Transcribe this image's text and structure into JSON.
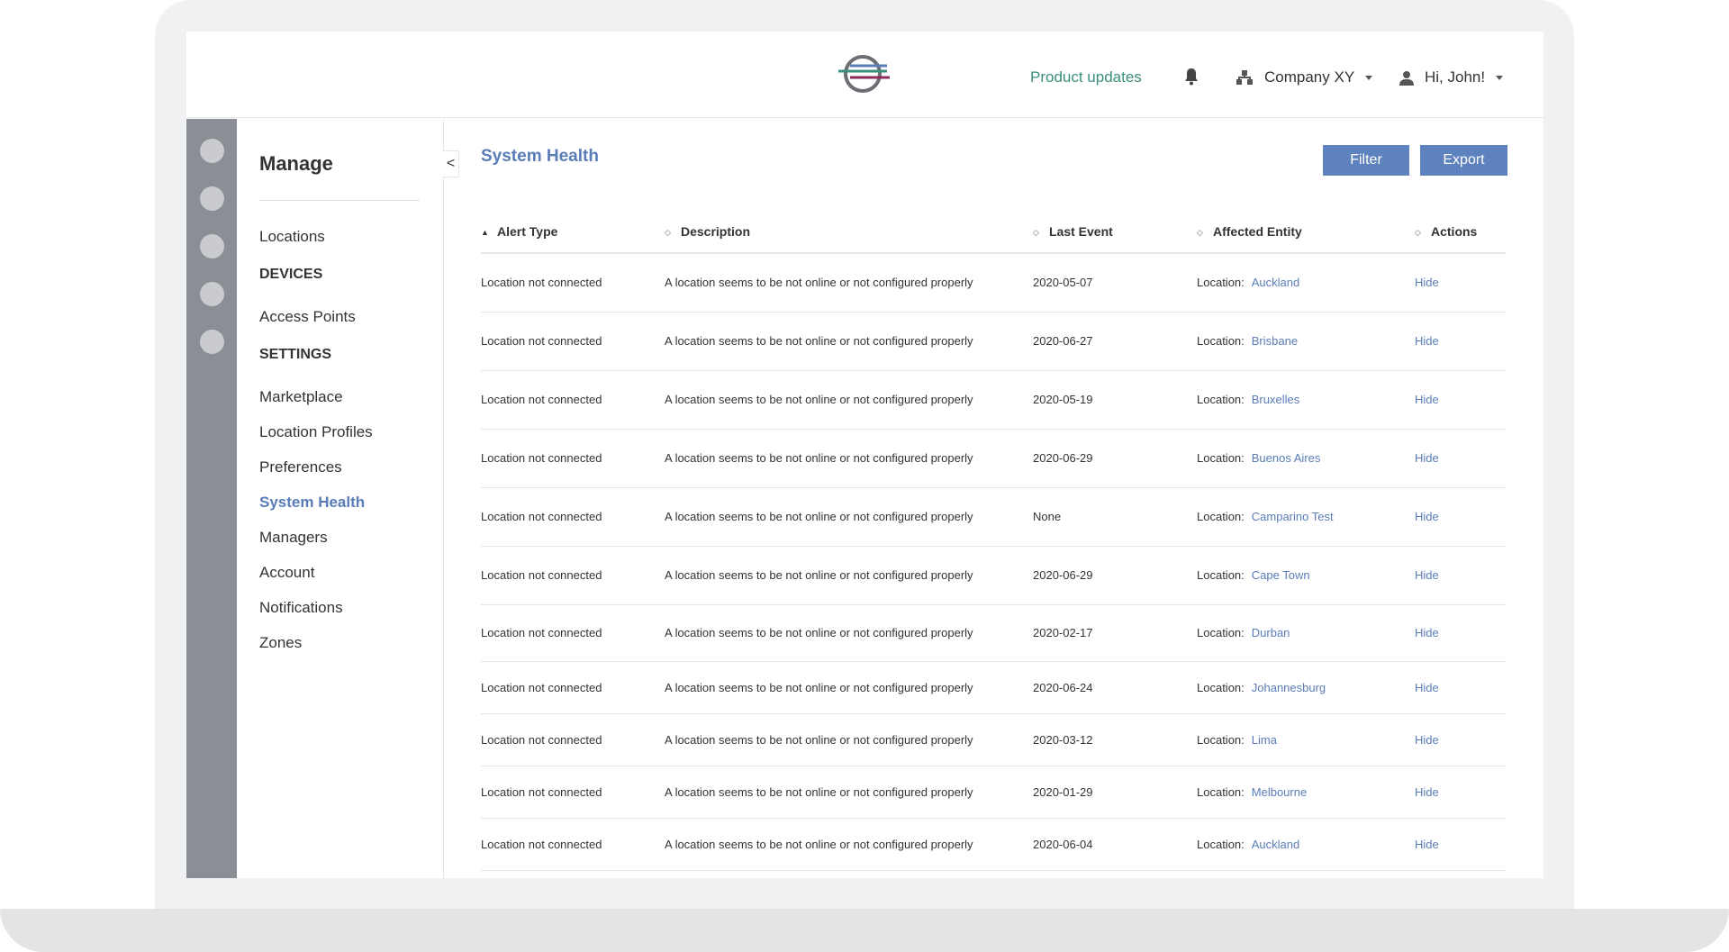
{
  "header": {
    "product_updates": "Product updates",
    "company": "Company XY",
    "greeting": "Hi, John!"
  },
  "rail": {
    "items": [
      "nav-dot",
      "nav-dot",
      "nav-dot",
      "nav-dot",
      "nav-dot"
    ]
  },
  "sidenav": {
    "title": "Manage",
    "locations": "Locations",
    "devices_heading": "DEVICES",
    "access_points": "Access Points",
    "settings_heading": "SETTINGS",
    "marketplace": "Marketplace",
    "location_profiles": "Location Profiles",
    "preferences": "Preferences",
    "system_health": "System Health",
    "managers": "Managers",
    "account": "Account",
    "notifications": "Notifications",
    "zones": "Zones",
    "collapse_glyph": "<"
  },
  "main": {
    "title": "System Health",
    "filter_label": "Filter",
    "export_label": "Export",
    "columns": [
      "Alert Type",
      "Description",
      "Last Event",
      "Affected Entity",
      "Actions"
    ],
    "location_prefix": "Location:",
    "rows": [
      {
        "alert": "Location not connected",
        "desc": "A location seems to be not online or not configured properly",
        "last": "2020-05-07",
        "entity": "Auckland",
        "action": "Hide"
      },
      {
        "alert": "Location not connected",
        "desc": "A location seems to be not online or not configured properly",
        "last": "2020-06-27",
        "entity": "Brisbane",
        "action": "Hide"
      },
      {
        "alert": "Location not connected",
        "desc": "A location seems to be not online or not configured properly",
        "last": "2020-05-19",
        "entity": "Bruxelles",
        "action": "Hide"
      },
      {
        "alert": "Location not connected",
        "desc": "A location seems to be not online or not configured properly",
        "last": "2020-06-29",
        "entity": "Buenos Aires",
        "action": "Hide"
      },
      {
        "alert": "Location not connected",
        "desc": "A location seems to be not online or not configured properly",
        "last": "None",
        "entity": "Camparino Test",
        "action": "Hide"
      },
      {
        "alert": "Location not connected",
        "desc": "A location seems to be not online or not configured properly",
        "last": "2020-06-29",
        "entity": "Cape Town",
        "action": "Hide"
      },
      {
        "alert": "Location not connected",
        "desc": "A location seems to be not online or not configured properly",
        "last": "2020-02-17",
        "entity": "Durban",
        "action": "Hide"
      },
      {
        "alert": "Location not connected",
        "desc": "A location seems to be not online or not configured properly",
        "last": "2020-06-24",
        "entity": "Johannesburg",
        "action": "Hide"
      },
      {
        "alert": "Location not connected",
        "desc": "A location seems to be not online or not configured properly",
        "last": "2020-03-12",
        "entity": "Lima",
        "action": "Hide"
      },
      {
        "alert": "Location not connected",
        "desc": "A location seems to be not online or not configured properly",
        "last": "2020-01-29",
        "entity": "Melbourne",
        "action": "Hide"
      },
      {
        "alert": "Location not connected",
        "desc": "A location seems to be not online or not configured properly",
        "last": "2020-06-04",
        "entity": "Auckland",
        "action": "Hide"
      }
    ]
  },
  "colors": {
    "accent": "#5a7db8",
    "button": "#5e82bd",
    "product_link": "#3a8f7e",
    "rail": "#8b8e95"
  }
}
